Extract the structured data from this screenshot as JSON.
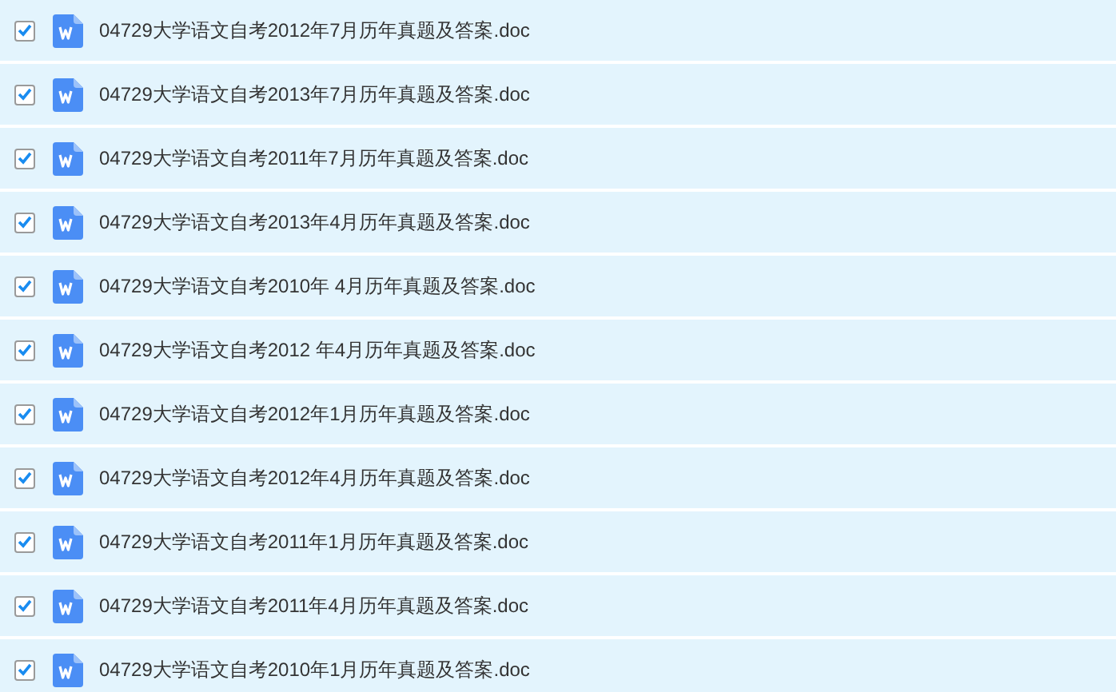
{
  "files": [
    {
      "name": "04729大学语文自考2012年7月历年真题及答案.doc",
      "checked": true
    },
    {
      "name": "04729大学语文自考2013年7月历年真题及答案.doc",
      "checked": true
    },
    {
      "name": "04729大学语文自考2011年7月历年真题及答案.doc",
      "checked": true
    },
    {
      "name": "04729大学语文自考2013年4月历年真题及答案.doc",
      "checked": true
    },
    {
      "name": "04729大学语文自考2010年 4月历年真题及答案.doc",
      "checked": true
    },
    {
      "name": "04729大学语文自考2012 年4月历年真题及答案.doc",
      "checked": true
    },
    {
      "name": "04729大学语文自考2012年1月历年真题及答案.doc",
      "checked": true
    },
    {
      "name": "04729大学语文自考2012年4月历年真题及答案.doc",
      "checked": true
    },
    {
      "name": "04729大学语文自考2011年1月历年真题及答案.doc",
      "checked": true
    },
    {
      "name": "04729大学语文自考2011年4月历年真题及答案.doc",
      "checked": true
    },
    {
      "name": "04729大学语文自考2010年1月历年真题及答案.doc",
      "checked": true
    }
  ]
}
